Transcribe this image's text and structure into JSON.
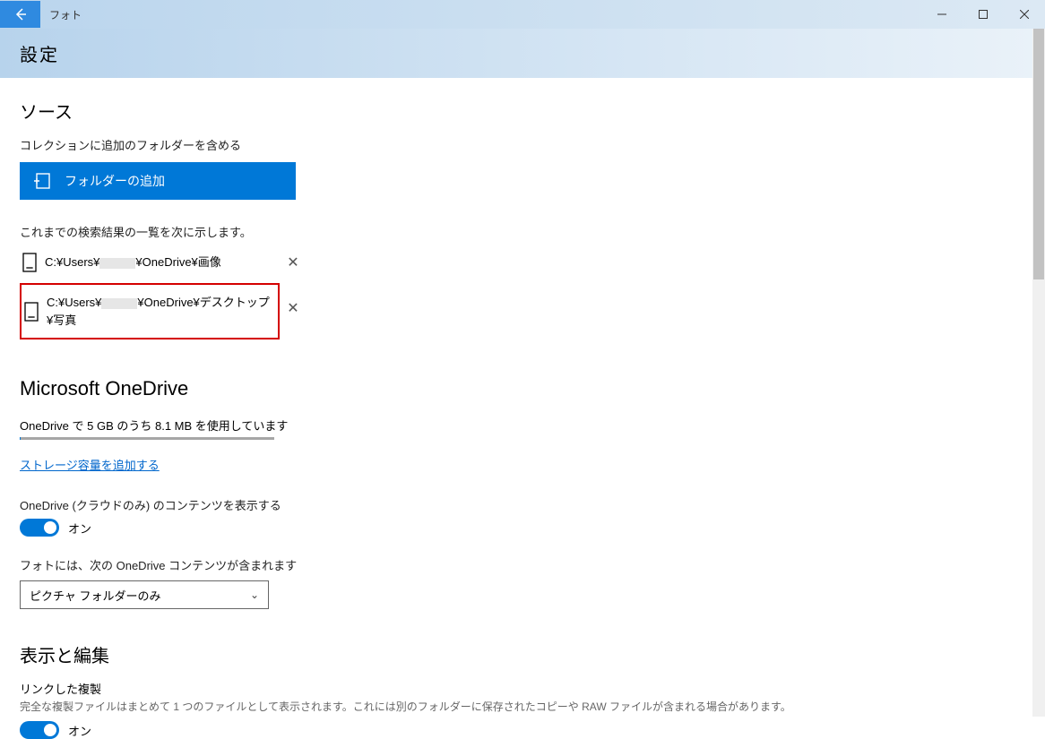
{
  "app": {
    "title": "フォト"
  },
  "page": {
    "title": "設定"
  },
  "sources": {
    "heading": "ソース",
    "include_label": "コレクションに追加のフォルダーを含める",
    "add_folder_label": "フォルダーの追加",
    "search_results_label": "これまでの検索結果の一覧を次に示します。",
    "folders": [
      {
        "path_prefix": "C:¥Users¥",
        "path_suffix": "¥OneDrive¥画像"
      },
      {
        "path_prefix": "C:¥Users¥",
        "path_suffix": "¥OneDrive¥デスクトップ¥写真"
      }
    ]
  },
  "onedrive": {
    "heading": "Microsoft OneDrive",
    "usage_text": "OneDrive で 5 GB のうち 8.1 MB を使用しています",
    "add_storage_link": "ストレージ容量を追加する",
    "cloud_only_label": "OneDrive (クラウドのみ) のコンテンツを表示する",
    "toggle_on": "オン",
    "contents_label": "フォトには、次の OneDrive コンテンツが含まれます",
    "dropdown_value": "ピクチャ フォルダーのみ"
  },
  "display_edit": {
    "heading": "表示と編集",
    "linked_dup_heading": "リンクした複製",
    "linked_dup_desc": "完全な複製ファイルはまとめて 1 つのファイルとして表示されます。これには別のフォルダーに保存されたコピーや RAW ファイルが含まれる場合があります。",
    "toggle_on": "オン"
  }
}
